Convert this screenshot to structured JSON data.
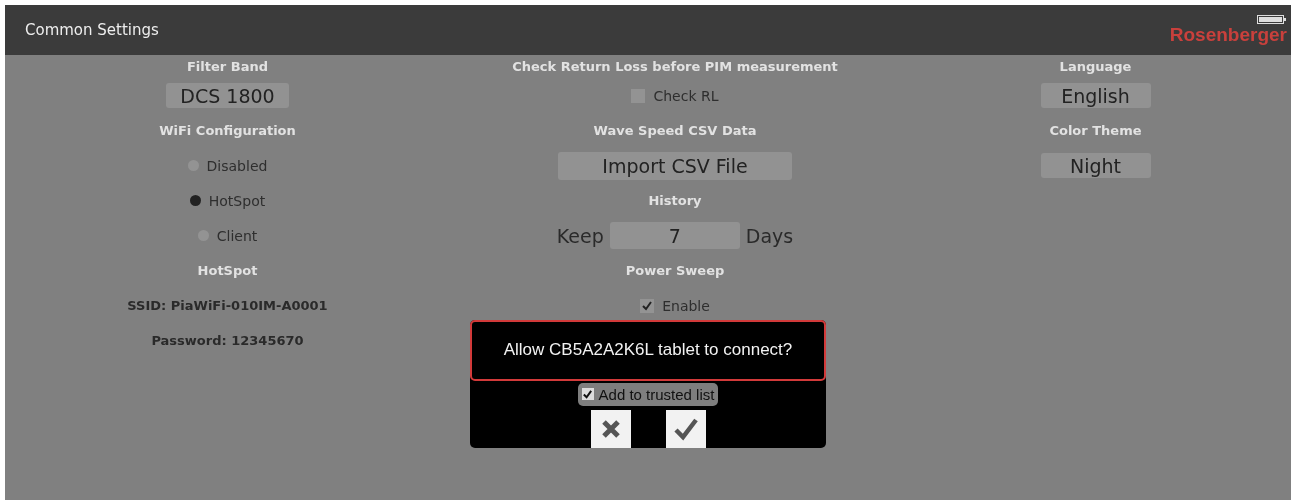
{
  "window": {
    "title": "Common Settings",
    "logo": "Rosenberger"
  },
  "columns": [
    [
      {
        "kind": "heading",
        "text": "Filter Band"
      },
      {
        "kind": "select",
        "text": "DCS 1800"
      },
      {
        "kind": "heading",
        "text": "WiFi Configuration"
      },
      {
        "kind": "radio",
        "text": "Disabled",
        "selected": false
      },
      {
        "kind": "radio",
        "text": "HotSpot",
        "selected": true
      },
      {
        "kind": "radio",
        "text": "Client",
        "selected": false
      },
      {
        "kind": "heading",
        "text": "HotSpot"
      },
      {
        "kind": "info",
        "text": "SSID: PiaWiFi-010IM-A0001"
      },
      {
        "kind": "info",
        "text": "Password: 12345670"
      }
    ],
    [
      {
        "kind": "heading",
        "text": "Check Return Loss before PIM measurement"
      },
      {
        "kind": "checkbox",
        "text": "Check RL",
        "checked": false
      },
      {
        "kind": "heading",
        "text": "Wave Speed CSV Data"
      },
      {
        "kind": "button",
        "text": "Import CSV File"
      },
      {
        "kind": "heading",
        "text": "History"
      },
      {
        "kind": "keep",
        "before": "Keep",
        "value": "7",
        "after": "Days"
      },
      {
        "kind": "heading",
        "text": "Power Sweep"
      },
      {
        "kind": "checkbox",
        "text": "Enable",
        "checked": true
      }
    ],
    [
      {
        "kind": "heading",
        "text": "Language"
      },
      {
        "kind": "select",
        "text": "English"
      },
      {
        "kind": "heading",
        "text": "Color Theme"
      },
      {
        "kind": "select",
        "text": "Night"
      }
    ]
  ],
  "dialog": {
    "message": "Allow CB5A2A2K6L tablet to connect?",
    "trusted": {
      "text": "Add to trusted list",
      "checked": true
    }
  }
}
